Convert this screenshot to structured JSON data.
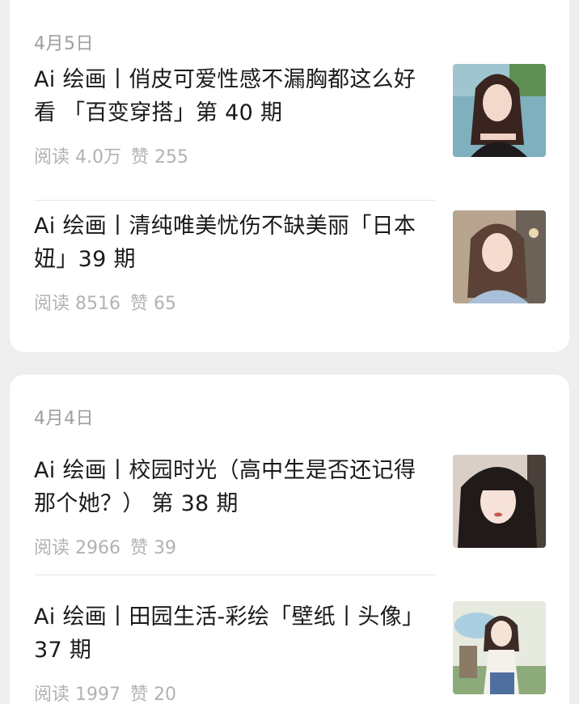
{
  "sections": [
    {
      "date": "4月5日",
      "articles": [
        {
          "title": "Ai 绘画丨俏皮可爱性感不漏胸都这么好看 「百变穿搭」第 40 期",
          "reads": "阅读 4.0万",
          "likes": "赞 255",
          "thumbnail": "portrait-lakeside-black-top"
        },
        {
          "title": "Ai 绘画丨清纯唯美忧伤不缺美丽「日本妞」39 期",
          "reads": "阅读 8516",
          "likes": "赞 65",
          "thumbnail": "portrait-street-blue-shirt"
        }
      ]
    },
    {
      "date": "4月4日",
      "articles": [
        {
          "title": "Ai 绘画丨校园时光（高中生是否还记得那个她？） 第 38 期",
          "reads": "阅读 2966",
          "likes": "赞 39",
          "thumbnail": "portrait-school-dark-hair"
        },
        {
          "title": "Ai 绘画丨田园生活-彩绘「壁纸丨头像」37 期",
          "reads": "阅读 1997",
          "likes": "赞 20",
          "thumbnail": "illustration-countryside-girl"
        }
      ]
    }
  ]
}
